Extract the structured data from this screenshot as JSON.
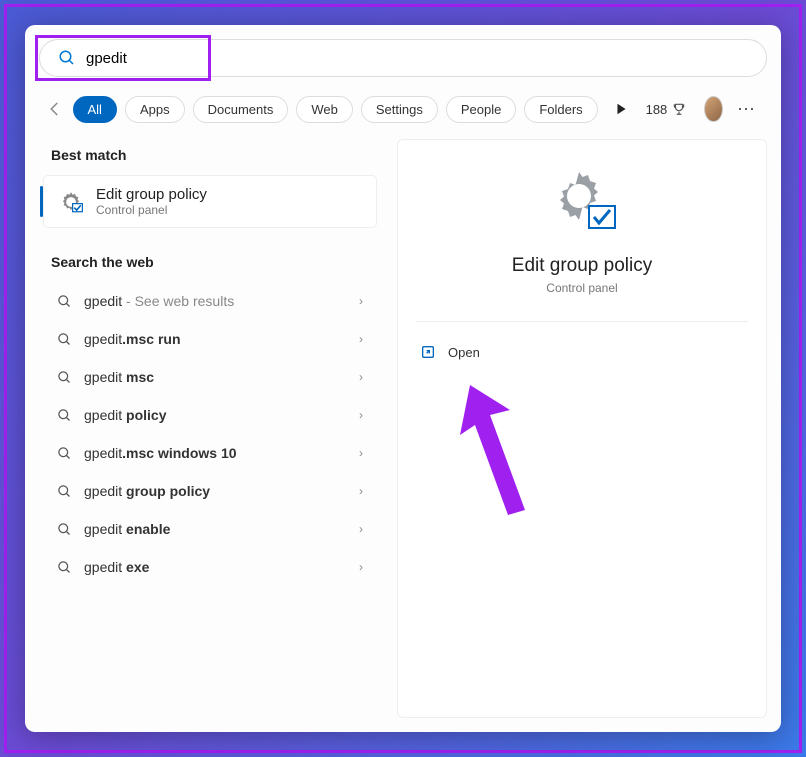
{
  "search": {
    "value": "gpedit"
  },
  "tabs": {
    "all": "All",
    "apps": "Apps",
    "documents": "Documents",
    "web": "Web",
    "settings": "Settings",
    "people": "People",
    "folders": "Folders"
  },
  "points": "188",
  "sections": {
    "best_match": "Best match",
    "search_web": "Search the web"
  },
  "best_match": {
    "title": "Edit group policy",
    "subtitle": "Control panel"
  },
  "web_results": [
    {
      "prefix": "gpedit",
      "bold": "",
      "suffix": " - See web results",
      "suffix_light": true
    },
    {
      "prefix": "gpedit",
      "bold": ".msc run",
      "suffix": ""
    },
    {
      "prefix": "gpedit ",
      "bold": "msc",
      "suffix": ""
    },
    {
      "prefix": "gpedit ",
      "bold": "policy",
      "suffix": ""
    },
    {
      "prefix": "gpedit",
      "bold": ".msc windows 10",
      "suffix": ""
    },
    {
      "prefix": "gpedit ",
      "bold": "group policy",
      "suffix": ""
    },
    {
      "prefix": "gpedit ",
      "bold": "enable",
      "suffix": ""
    },
    {
      "prefix": "gpedit ",
      "bold": "exe",
      "suffix": ""
    }
  ],
  "detail": {
    "title": "Edit group policy",
    "subtitle": "Control panel",
    "action_open": "Open"
  }
}
